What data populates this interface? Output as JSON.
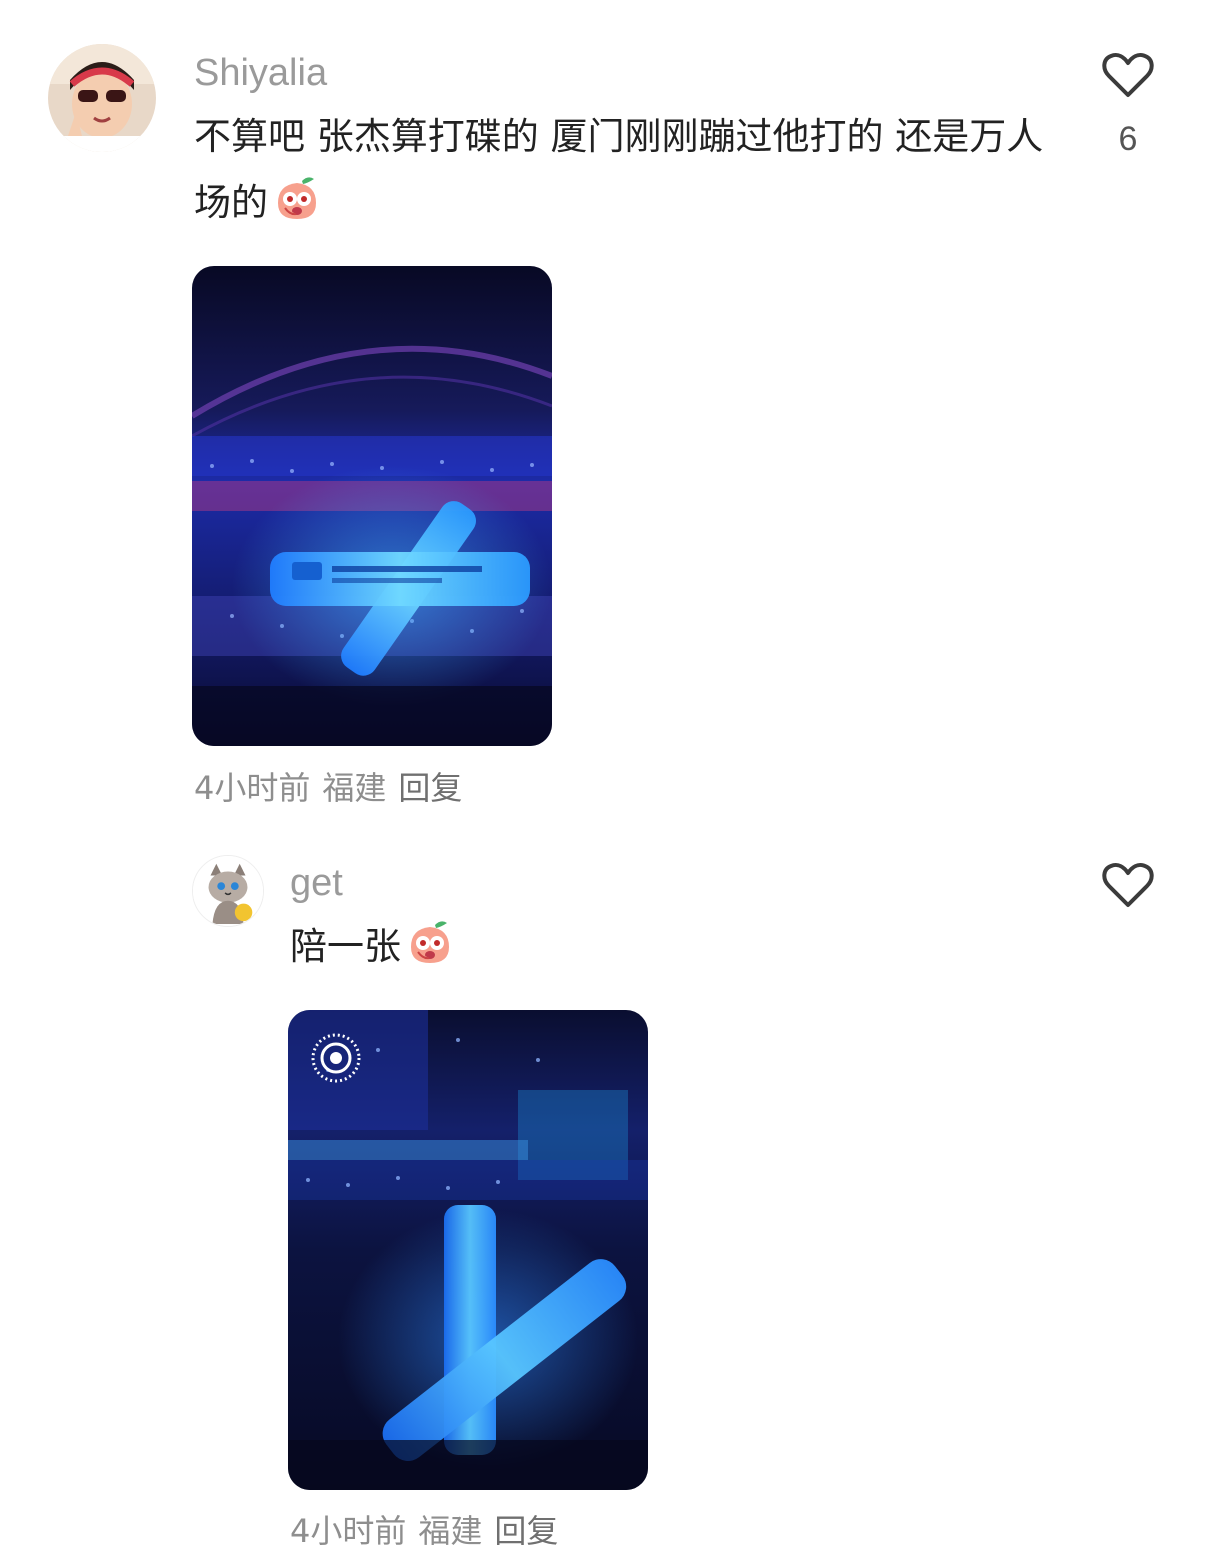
{
  "comments": [
    {
      "username": "Shiyalia",
      "text": "不算吧  张杰算打碟的 厦门刚刚蹦过他打的 还是万人场的",
      "sticker_icon": "peach-face-sticker-icon",
      "like_count": "6",
      "time": "4小时前",
      "location": "福建",
      "reply_label": "回复"
    },
    {
      "username": "get",
      "text": "陪一张",
      "sticker_icon": "peach-face-sticker-icon",
      "live_photo_icon": "live-photo-icon",
      "time": "4小时前",
      "location": "福建",
      "reply_label": "回复"
    }
  ],
  "colors": {
    "username": "#9a9a9a",
    "text": "#222222",
    "meta": "#8e8e8e",
    "stick_glow": "#39b8ff"
  }
}
